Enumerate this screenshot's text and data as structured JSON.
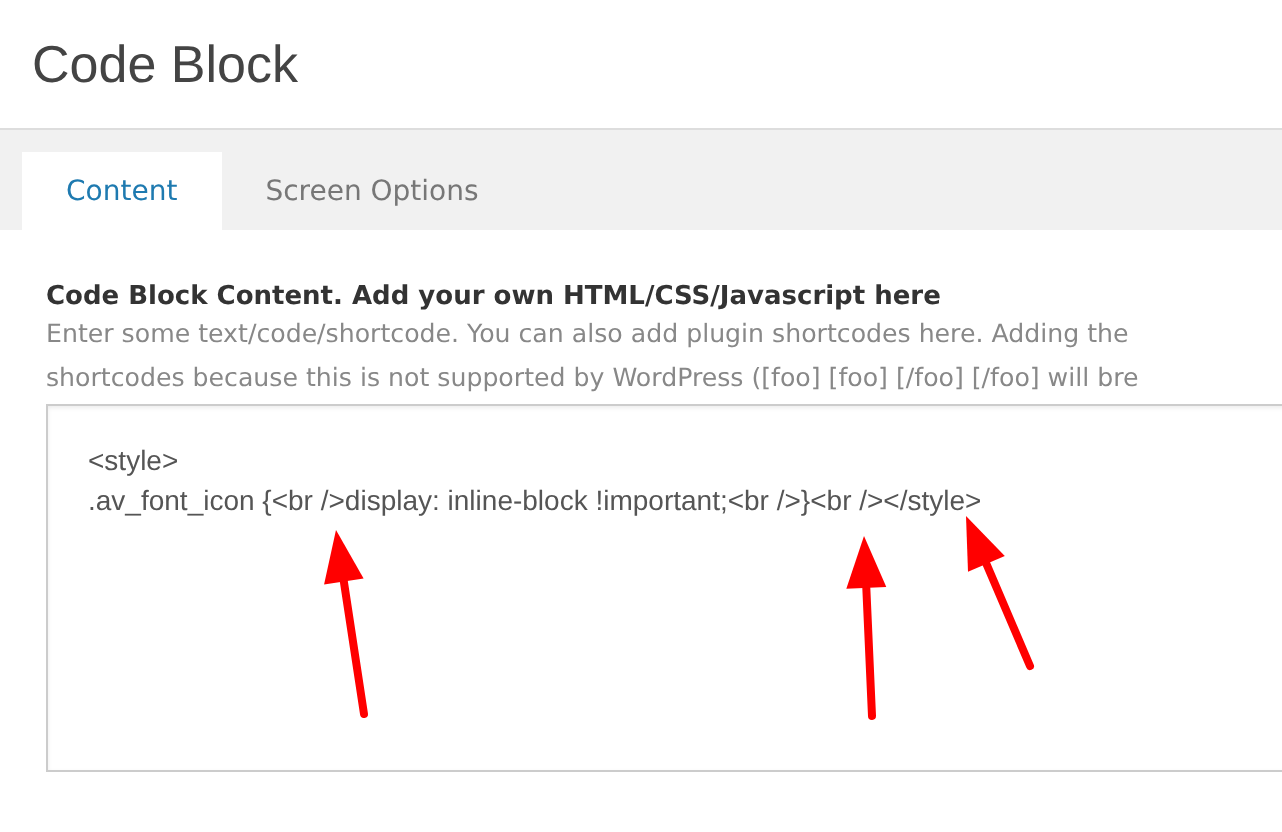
{
  "header": {
    "title": "Code Block"
  },
  "tabs": [
    {
      "label": "Content",
      "selected": true
    },
    {
      "label": "Screen Options",
      "selected": false
    }
  ],
  "field": {
    "label": "Code Block Content. Add your own HTML/CSS/Javascript here",
    "description_lines": [
      "Enter some text/code/shortcode. You can also add plugin shortcodes here. Adding the",
      "shortcodes because this is not supported by WordPress ([foo] [foo] [/foo] [/foo] will bre"
    ],
    "value_lines": [
      "<style>",
      ".av_font_icon {<br />display: inline-block !important;<br />}<br /></style>"
    ]
  },
  "annotations": [
    {
      "kind": "arrow"
    },
    {
      "kind": "arrow"
    },
    {
      "kind": "arrow"
    }
  ]
}
